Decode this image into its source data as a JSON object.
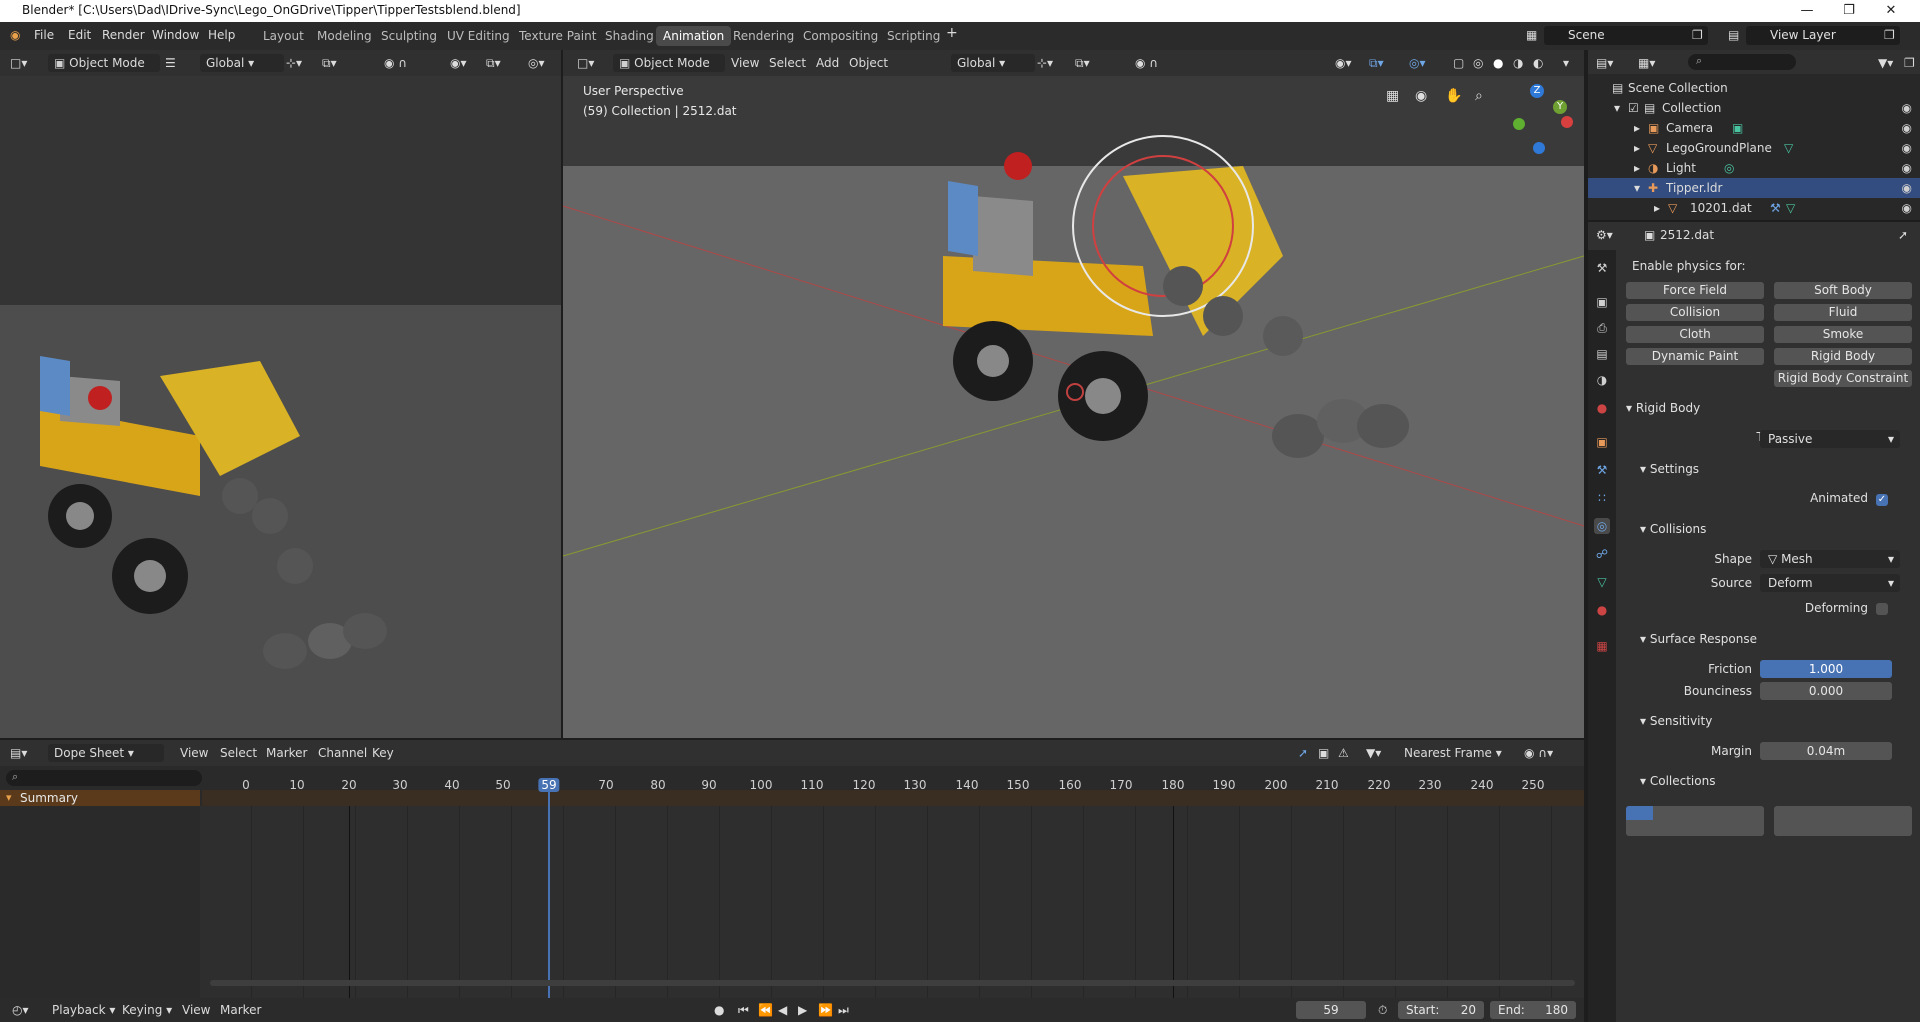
{
  "window": {
    "title": "Blender* [C:\\Users\\Dad\\IDrive-Sync\\Lego_OnGDrive\\Tipper\\TipperTestsblend.blend]"
  },
  "menu": [
    "File",
    "Edit",
    "Render",
    "Window",
    "Help"
  ],
  "workspaces": [
    "Layout",
    "Modeling",
    "Sculpting",
    "UV Editing",
    "Texture Paint",
    "Shading",
    "Animation",
    "Rendering",
    "Compositing",
    "Scripting"
  ],
  "active_workspace": "Animation",
  "scene": "Scene",
  "view_layer": "View Layer",
  "left_view": {
    "mode": "Object Mode",
    "orientation": "Global"
  },
  "main_view": {
    "mode": "Object Mode",
    "menus": [
      "View",
      "Select",
      "Add",
      "Object"
    ],
    "orientation": "Global",
    "info_line1": "User Perspective",
    "info_line2": "(59) Collection | 2512.dat",
    "gizmo_axes": [
      "Z",
      "Y"
    ]
  },
  "outliner": {
    "rows": [
      {
        "label": "Scene Collection"
      },
      {
        "label": "Collection"
      },
      {
        "label": "Camera"
      },
      {
        "label": "LegoGroundPlane"
      },
      {
        "label": "Light"
      },
      {
        "label": "Tipper.ldr"
      },
      {
        "label": "10201.dat"
      }
    ]
  },
  "properties": {
    "object_name": "2512.dat",
    "enable_physics_label": "Enable physics for:",
    "physics_buttons": [
      "Force Field",
      "Soft Body",
      "Collision",
      "Fluid",
      "Cloth",
      "Smoke",
      "Dynamic Paint",
      "Rigid Body",
      "Rigid Body Constraint"
    ],
    "rigid_body": {
      "section": "Rigid Body",
      "type_label": "Type",
      "type_value": "Passive",
      "settings_section": "Settings",
      "animated_label": "Animated",
      "animated": true,
      "collisions_section": "Collisions",
      "shape_label": "Shape",
      "shape_value": "Mesh",
      "source_label": "Source",
      "source_value": "Deform",
      "deforming_label": "Deforming",
      "deforming": false,
      "surface_section": "Surface Response",
      "friction_label": "Friction",
      "friction_value": "1.000",
      "bounciness_label": "Bounciness",
      "bounciness_value": "0.000",
      "sensitivity_section": "Sensitivity",
      "margin_label": "Margin",
      "margin_value": "0.04m",
      "collections_section": "Collections"
    }
  },
  "dopesheet": {
    "editor": "Dope Sheet",
    "menus": [
      "View",
      "Select",
      "Marker",
      "Channel",
      "Key"
    ],
    "snap": "Nearest Frame",
    "summary": "Summary",
    "ticks": [
      "0",
      "10",
      "20",
      "30",
      "40",
      "50",
      "59",
      "70",
      "80",
      "90",
      "100",
      "110",
      "120",
      "130",
      "140",
      "150",
      "160",
      "170",
      "180",
      "190",
      "200",
      "210",
      "220",
      "230",
      "240",
      "250"
    ]
  },
  "timeline": {
    "menus": [
      "Playback",
      "Keying",
      "View",
      "Marker"
    ],
    "current_frame": "59",
    "start_label": "Start:",
    "start": "20",
    "end_label": "End:",
    "end": "180"
  },
  "colors": {
    "accent": "#4772b3",
    "selected_row": "#334d80",
    "summary_bar": "#5a3a1a"
  }
}
